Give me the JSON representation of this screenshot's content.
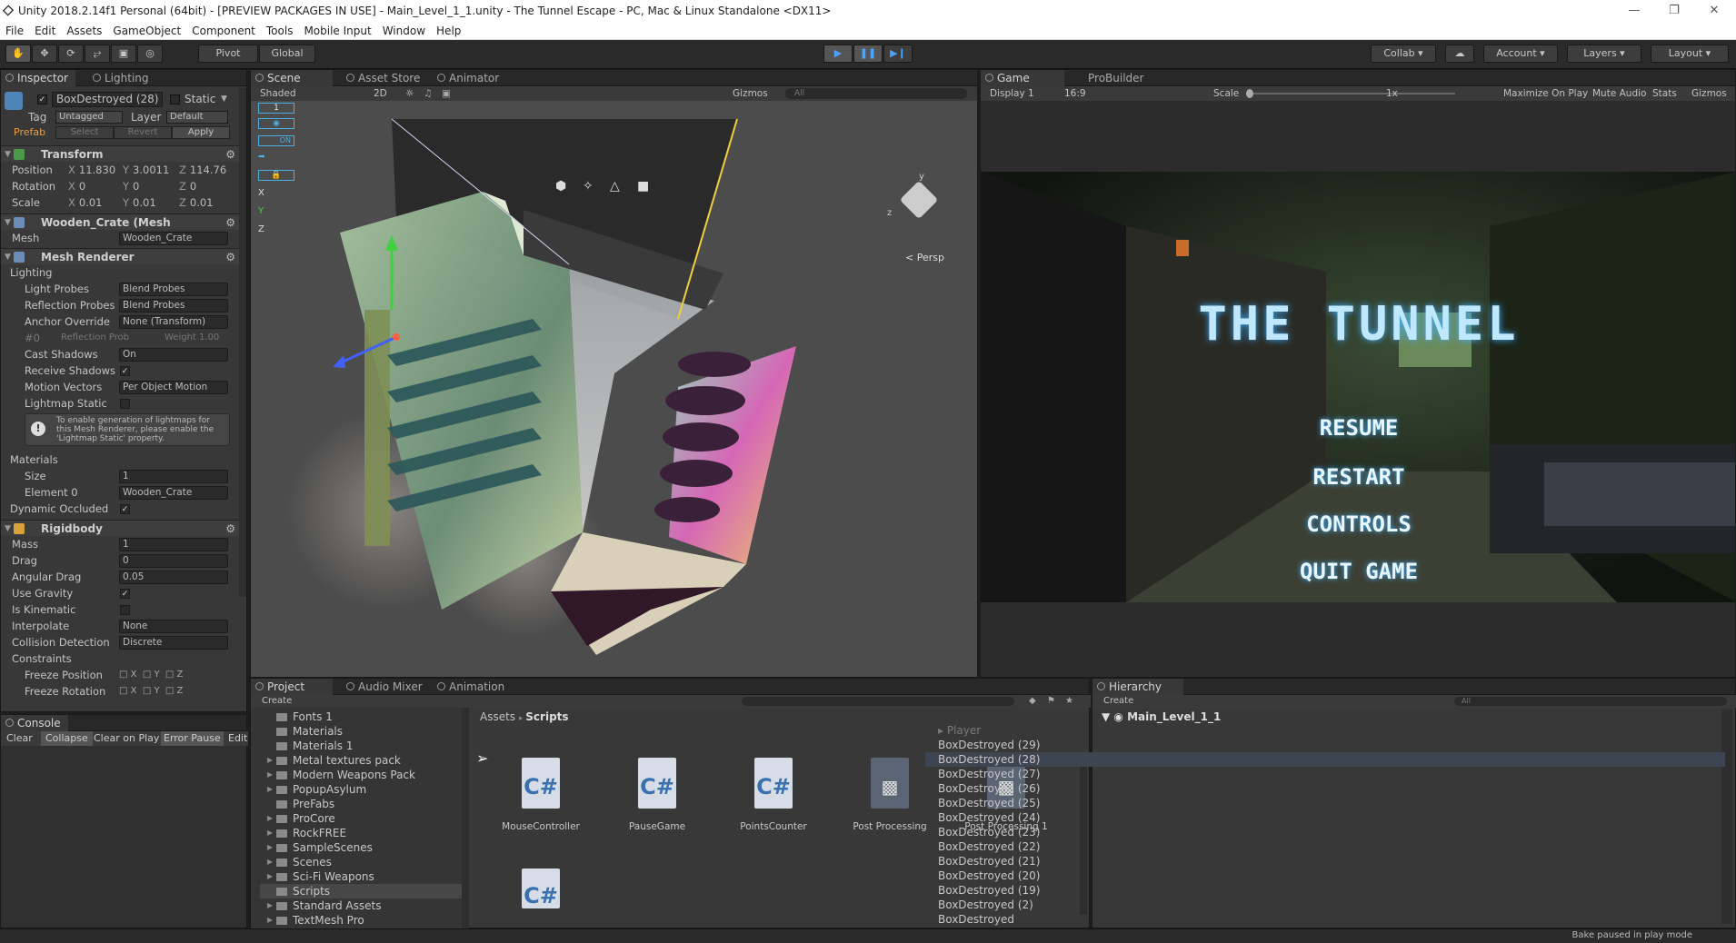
{
  "window": {
    "title": "Unity 2018.2.14f1 Personal (64bit) - [PREVIEW PACKAGES IN USE] - Main_Level_1_1.unity - The Tunnel Escape - PC, Mac & Linux Standalone <DX11>"
  },
  "menu": [
    "File",
    "Edit",
    "Assets",
    "GameObject",
    "Component",
    "Tools",
    "Mobile Input",
    "Window",
    "Help"
  ],
  "toolbar": {
    "pivot": "Pivot",
    "global": "Global",
    "collab": "Collab",
    "account": "Account",
    "layers": "Layers",
    "layout": "Layout"
  },
  "inspector": {
    "tab_inspector": "Inspector",
    "tab_lighting": "Lighting",
    "object_name": "BoxDestroyed (28)",
    "static_label": "Static",
    "tag_label": "Tag",
    "tag_value": "Untagged",
    "layer_label": "Layer",
    "layer_value": "Default",
    "prefab_label": "Prefab",
    "select": "Select",
    "revert": "Revert",
    "apply": "Apply",
    "transform": {
      "title": "Transform",
      "position_label": "Position",
      "rotation_label": "Rotation",
      "scale_label": "Scale",
      "pos": [
        "11.830",
        "3.0011",
        "114.76"
      ],
      "rot": [
        "0",
        "0",
        "0"
      ],
      "scl": [
        "0.01",
        "0.01",
        "0.01"
      ]
    },
    "mesh_filter": {
      "title": "Wooden_Crate (Mesh",
      "mesh_label": "Mesh",
      "mesh_value": "Wooden_Crate"
    },
    "mesh_renderer": {
      "title": "Mesh Renderer",
      "lighting": "Lighting",
      "rows": [
        {
          "label": "Light Probes",
          "value": "Blend Probes"
        },
        {
          "label": "Reflection Probes",
          "value": "Blend Probes"
        },
        {
          "label": "Anchor Override",
          "value": "None (Transform)"
        },
        {
          "label": "#0",
          "value": "Reflection Prob"
        },
        {
          "label": "Cast Shadows",
          "value": "On"
        }
      ],
      "weight": "Weight 1.00",
      "receive_shadows": "Receive Shadows",
      "motion_vectors": "Motion Vectors",
      "motion_vectors_value": "Per Object Motion",
      "lightmap_static": "Lightmap Static",
      "info": "To enable generation of lightmaps for this Mesh Renderer, please enable the 'Lightmap Static' property.",
      "materials": "Materials",
      "size_label": "Size",
      "size_value": "1",
      "element0_label": "Element 0",
      "element0_value": "Wooden_Crate",
      "dynamic_occluded": "Dynamic Occluded"
    },
    "rigidbody": {
      "title": "Rigidbody",
      "mass": "Mass",
      "mass_v": "1",
      "drag": "Drag",
      "drag_v": "0",
      "angular_drag": "Angular Drag",
      "angular_drag_v": "0.05",
      "use_gravity": "Use Gravity",
      "is_kinematic": "Is Kinematic",
      "interpolate": "Interpolate",
      "interpolate_v": "None",
      "collision": "Collision Detection",
      "collision_v": "Discrete",
      "constraints": "Constraints",
      "freeze_pos": "Freeze Position",
      "freeze_rot": "Freeze Rotation"
    }
  },
  "console": {
    "tab": "Console",
    "buttons": [
      "Clear",
      "Collapse",
      "Clear on Play",
      "Error Pause",
      "Edit"
    ]
  },
  "scene": {
    "tab_scene": "Scene",
    "tab_store": "Asset Store",
    "tab_animator": "Animator",
    "shaded": "Shaded",
    "mode2d": "2D",
    "gizmos": "Gizmos",
    "search": "All",
    "persp": "Persp",
    "axis_y": "y",
    "axis_z": "z"
  },
  "game": {
    "tab_game": "Game",
    "tab_probuilder": "ProBuilder",
    "display": "Display 1",
    "aspect": "16:9",
    "scale_label": "Scale",
    "scale_value": "1x",
    "maximize": "Maximize On Play",
    "mute": "Mute Audio",
    "stats": "Stats",
    "gizmos": "Gizmos",
    "menu_title": "THE TUNNEL",
    "menu_items": [
      "RESUME",
      "RESTART",
      "CONTROLS",
      "QUIT GAME"
    ]
  },
  "project": {
    "tab_project": "Project",
    "tab_mixer": "Audio Mixer",
    "tab_animation": "Animation",
    "create": "Create",
    "breadcrumb_root": "Assets",
    "breadcrumb_current": "Scripts",
    "folders": [
      "Fonts 1",
      "Materials",
      "Materials 1",
      "Metal textures pack",
      "Modern Weapons Pack",
      "PopupAsylum",
      "PreFabs",
      "ProCore",
      "RockFREE",
      "SampleScenes",
      "Scenes",
      "Sci-Fi Weapons",
      "Scripts",
      "Standard Assets",
      "TextMesh Pro"
    ],
    "assets": [
      {
        "name": "MouseController",
        "type": "C#"
      },
      {
        "name": "PauseGame",
        "type": "C#"
      },
      {
        "name": "PointsCounter",
        "type": "C#"
      },
      {
        "name": "Post Processing",
        "type": "PP"
      },
      {
        "name": "Post Processing 1",
        "type": "PP"
      }
    ]
  },
  "hierarchy": {
    "tab": "Hierarchy",
    "create": "Create",
    "search": "All",
    "scene": "Main_Level_1_1",
    "items": [
      "Player",
      "BoxDestroyed (29)",
      "BoxDestroyed (28)",
      "BoxDestroyed (27)",
      "BoxDestroyed (26)",
      "BoxDestroyed (25)",
      "BoxDestroyed (24)",
      "BoxDestroyed (23)",
      "BoxDestroyed (22)",
      "BoxDestroyed (21)",
      "BoxDestroyed (20)",
      "BoxDestroyed (19)",
      "BoxDestroyed (2)",
      "BoxDestroyed"
    ]
  },
  "status": {
    "text": "Bake paused in play mode"
  }
}
